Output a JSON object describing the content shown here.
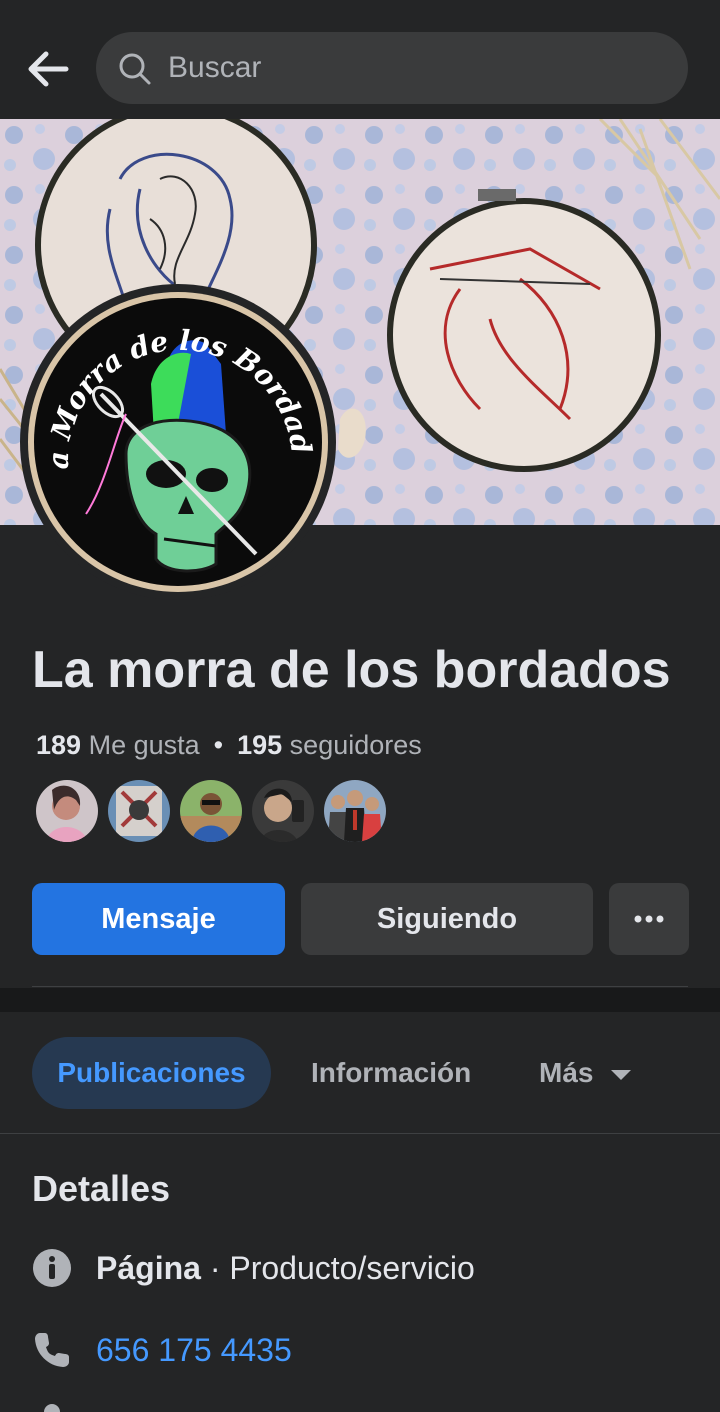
{
  "search": {
    "placeholder": "Buscar"
  },
  "page": {
    "name": "La morra de los bordados",
    "logo_text": "La Morra de los Bordados",
    "likes_count": "189",
    "likes_label": "Me gusta",
    "followers_count": "195",
    "followers_label": "seguidores"
  },
  "actions": {
    "message_label": "Mensaje",
    "following_label": "Siguiendo",
    "more_label": "···"
  },
  "tabs": [
    {
      "label": "Publicaciones",
      "active": true
    },
    {
      "label": "Información",
      "active": false
    },
    {
      "label": "Más",
      "active": false
    }
  ],
  "details": {
    "title": "Detalles",
    "category_prefix": "Página",
    "category_value": " · Producto/servicio",
    "phone": "656 175 4435"
  },
  "colors": {
    "background": "#242526",
    "accent": "#2374e1",
    "link": "#4599ff",
    "secondary_button": "#3a3b3c"
  }
}
